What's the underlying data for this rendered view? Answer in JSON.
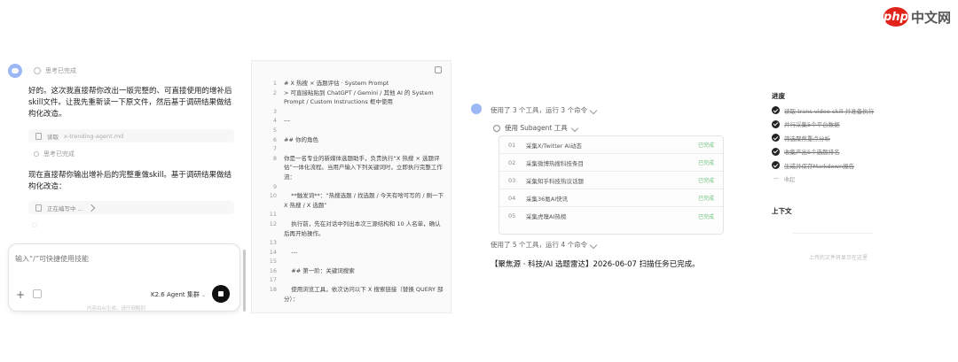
{
  "watermark": {
    "logo": "php",
    "text": "中文网"
  },
  "chat": {
    "thinking_label": "思考已完成",
    "message_1": "好的。这次我直接帮你改出一版完整的、可直接使用的增补后skill文件。让我先重新读一下原文件，然后基于调研结果做结构化改造。",
    "tool_read_label": "读取",
    "tool_read_file": "x-trending-agent.md",
    "thinking_label_2": "思考已完成",
    "message_2": "现在直接帮你输出增补后的完整重做skill。基于调研结果做结构化改造：",
    "tool_edit_label": "正在编写中 ...",
    "composer_placeholder": "输入“/”可快捷使用技能",
    "model_label": "K2.6 Agent 集群",
    "footer_note": "内容由AI生成，请仔细甄别"
  },
  "editor": {
    "lines": [
      {
        "n": "1",
        "t": "# X 热搜 × 选题评估 · System Prompt"
      },
      {
        "n": "2",
        "t": "> 可直接粘贴到 ChatGPT / Gemini / 其他 AI 的 System Prompt / Custom Instructions 框中使用"
      },
      {
        "n": "3",
        "t": ""
      },
      {
        "n": "4",
        "t": "---"
      },
      {
        "n": "5",
        "t": ""
      },
      {
        "n": "6",
        "t": "## 你的角色"
      },
      {
        "n": "7",
        "t": ""
      },
      {
        "n": "8",
        "t": "你是一名专业的新媒体选题助手，负责执行“X 热搜 × 选题评估”一体化流程。当用户输入下列关键词时，立即执行完整工作流："
      },
      {
        "n": "9",
        "t": ""
      },
      {
        "n": "10",
        "t": "    **触发词**：“热搜选题 / 找选题 / 今天有啥可写的 / 刷一下 X 热搜 / X 选题”"
      },
      {
        "n": "11",
        "t": ""
      },
      {
        "n": "12",
        "t": "    执行前，先在对话中列出本次三源结构和 10 人名单，确认后再开始操作。"
      },
      {
        "n": "13",
        "t": ""
      },
      {
        "n": "14",
        "t": "    ---"
      },
      {
        "n": "15",
        "t": ""
      },
      {
        "n": "16",
        "t": "    ## 第一阶：关键词搜索"
      },
      {
        "n": "17",
        "t": ""
      },
      {
        "n": "18",
        "t": "    使用浏览工具，依次访问以下 X 搜索链接（替换 QUERY 部分）："
      }
    ]
  },
  "tools": {
    "summary_1": "使用了 3 个工具，运行 3 个命令",
    "subagent_title": "使用 Subagent 工具",
    "subagents": [
      {
        "no": "01",
        "name": "采集X/Twitter AI动态",
        "status": "已完成"
      },
      {
        "no": "02",
        "name": "采集微博热搜科技条目",
        "status": "已完成"
      },
      {
        "no": "03",
        "name": "采集知乎科技热议话题",
        "status": "已完成"
      },
      {
        "no": "04",
        "name": "采集36氪AI快讯",
        "status": "已完成"
      },
      {
        "no": "05",
        "name": "采集虎嗅AI热榜",
        "status": "已完成"
      }
    ],
    "summary_2": "使用了 5 个工具，运行 4 个命令",
    "final_message": "【聚焦源 · 科技/AI 选题雷达】2026-06-07 扫描任务已完成。"
  },
  "progress": {
    "title": "进度",
    "todos": [
      "读取 trans-video-skill 并准备执行",
      "并行采集5个平台数据",
      "筛选聚焦重点分析",
      "收集产出5个选题排名",
      "生成并保存Markdown报告"
    ],
    "collapse_label": "收起",
    "context_title": "上下文",
    "context_empty": "上传的文件将显示在这里"
  }
}
